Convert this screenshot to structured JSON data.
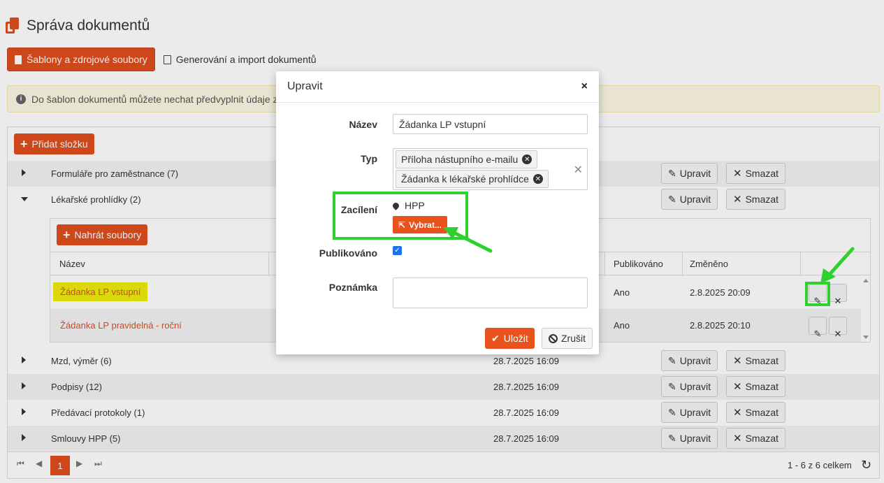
{
  "header": {
    "title": "Správa dokumentů"
  },
  "tabs": [
    {
      "label": "Šablony a zdrojové soubory",
      "active": true
    },
    {
      "label": "Generování a import dokumentů",
      "active": false
    }
  ],
  "info": {
    "text": "Do šablon dokumentů můžete nechat předvyplnit údaje z"
  },
  "grid": {
    "add_folder_label": "Přidat složku",
    "folders": [
      {
        "name": "Formuláře pro zaměstnance (7)",
        "date": "",
        "expanded": false
      },
      {
        "name": "Lékařské prohlídky (2)",
        "date": "",
        "expanded": true
      },
      {
        "name": "Mzd, výměr (6)",
        "date": "28.7.2025 16:09",
        "expanded": false
      },
      {
        "name": "Podpisy (12)",
        "date": "28.7.2025 16:09",
        "expanded": false
      },
      {
        "name": "Předávací protokoly (1)",
        "date": "28.7.2025 16:09",
        "expanded": false
      },
      {
        "name": "Smlouvy HPP (5)",
        "date": "28.7.2025 16:09",
        "expanded": false
      }
    ],
    "edit_label": "Upravit",
    "delete_label": "Smazat",
    "detail": {
      "upload_label": "Nahrát soubory",
      "headers": {
        "name": "Název",
        "published": "Publikováno",
        "changed": "Změněno"
      },
      "rows": [
        {
          "name": "Žádanka LP vstupní",
          "published": "Ano",
          "changed": "2.8.2025 20:09",
          "highlighted": true
        },
        {
          "name": "Žádanka LP pravidelná - roční",
          "published": "Ano",
          "changed": "2.8.2025 20:10",
          "highlighted": false
        }
      ]
    },
    "pager": {
      "current_page": "1",
      "summary": "1 - 6 z 6 celkem"
    }
  },
  "modal": {
    "title": "Upravit",
    "close_glyph": "×",
    "fields": {
      "name_label": "Název",
      "name_value": "Žádanka LP vstupní",
      "type_label": "Typ",
      "type_tags": [
        "Příloha nástupního e-mailu",
        "Žádanka k lékařské prohlídce"
      ],
      "targeting_label": "Zacílení",
      "targeting_value": "HPP",
      "select_label": "Vybrat...",
      "published_label": "Publikováno",
      "published_checked": true,
      "note_label": "Poznámka",
      "note_value": ""
    },
    "save_label": "Uložit",
    "cancel_label": "Zrušit"
  },
  "colors": {
    "accent": "#e04e1e",
    "highlight": "#ecec0c",
    "annotation": "#2fd12f"
  }
}
